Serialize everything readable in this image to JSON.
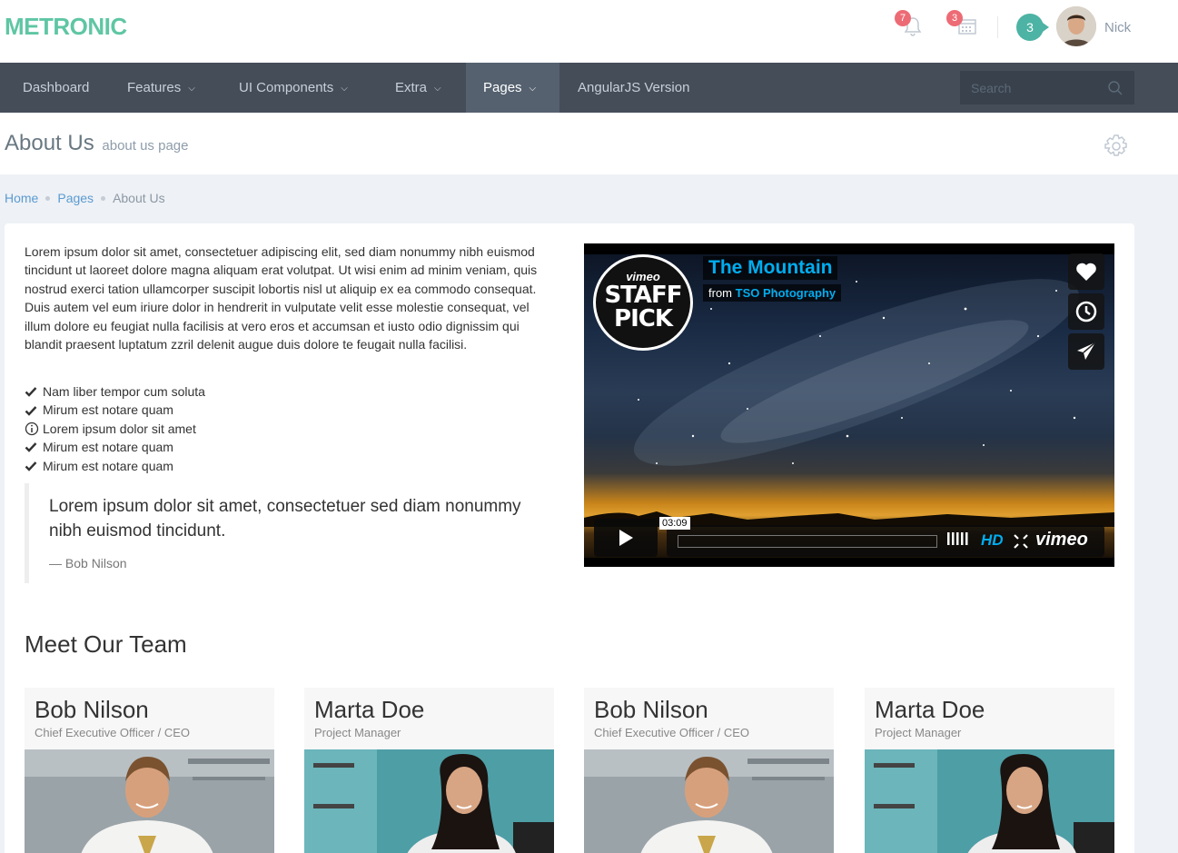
{
  "header": {
    "logo": "METRONIC",
    "notifications_count": "7",
    "calendar_count": "3",
    "inbox_count": "3",
    "username": "Nick"
  },
  "nav": {
    "items": [
      {
        "label": "Dashboard",
        "dropdown": false
      },
      {
        "label": "Features",
        "dropdown": true
      },
      {
        "label": "UI Components",
        "dropdown": true
      },
      {
        "label": "Extra",
        "dropdown": true
      },
      {
        "label": "Pages",
        "dropdown": true,
        "active": true
      },
      {
        "label": "AngularJS Version",
        "dropdown": false
      }
    ],
    "search_placeholder": "Search"
  },
  "page": {
    "title": "About Us",
    "subtitle": "about us page"
  },
  "breadcrumb": {
    "home": "Home",
    "pages": "Pages",
    "current": "About Us"
  },
  "content": {
    "paragraph": "Lorem ipsum dolor sit amet, consectetuer adipiscing elit, sed diam nonummy nibh euismod tincidunt ut laoreet dolore magna aliquam erat volutpat. Ut wisi enim ad minim veniam, quis nostrud exerci tation ullamcorper suscipit lobortis nisl ut aliquip ex ea commodo consequat. Duis autem vel eum iriure dolor in hendrerit in vulputate velit esse molestie consequat, vel illum dolore eu feugiat nulla facilisis at vero eros et accumsan et iusto odio dignissim qui blandit praesent luptatum zzril delenit augue duis dolore te feugait nulla facilisi.",
    "list": [
      {
        "text": "Nam liber tempor cum soluta",
        "icon": "check-icon"
      },
      {
        "text": "Mirum est notare quam",
        "icon": "check-icon"
      },
      {
        "text": "Lorem ipsum dolor sit amet",
        "icon": "info-icon"
      },
      {
        "text": "Mirum est notare quam",
        "icon": "check-icon"
      },
      {
        "text": "Mirum est notare quam",
        "icon": "check-icon"
      }
    ],
    "quote": "Lorem ipsum dolor sit amet, consectetuer sed diam nonummy nibh euismod tincidunt.",
    "quote_author": "— Bob Nilson"
  },
  "video": {
    "badge_top": "vimeo",
    "badge_line1": "STAFF",
    "badge_line2": "PICK",
    "title": "The Mountain",
    "from_label": "from",
    "author": "TSO Photography",
    "timecode": "03:09",
    "hd_label": "HD",
    "brand": "vimeo"
  },
  "team": {
    "title": "Meet Our Team",
    "members": [
      {
        "name": "Bob Nilson",
        "role": "Chief Executive Officer / CEO"
      },
      {
        "name": "Marta Doe",
        "role": "Project Manager"
      },
      {
        "name": "Bob Nilson",
        "role": "Chief Executive Officer / CEO"
      },
      {
        "name": "Marta Doe",
        "role": "Project Manager"
      }
    ]
  }
}
